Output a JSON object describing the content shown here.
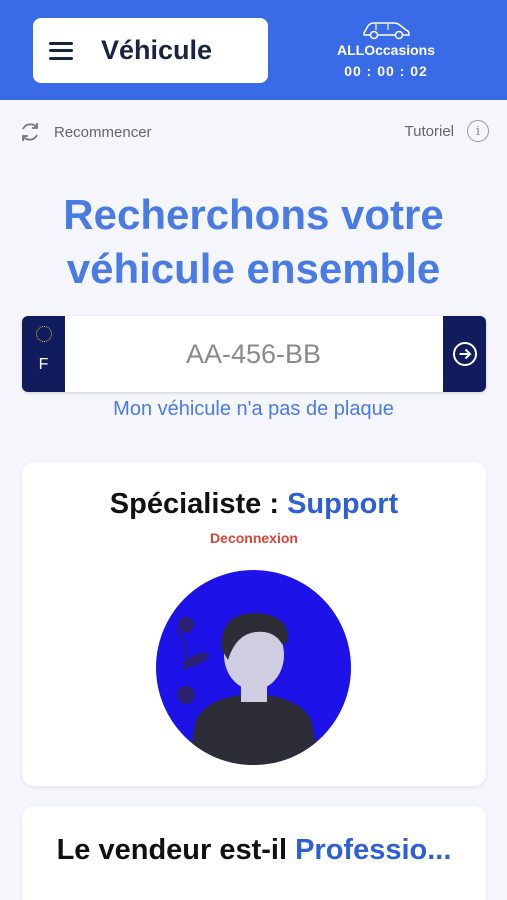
{
  "header": {
    "menu_title": "Véhicule",
    "brand_name": "ALLOccasions",
    "timer": "00 : 00 : 02"
  },
  "toolbar": {
    "restart_label": "Recommencer",
    "tutorial_label": "Tutoriel"
  },
  "hero": {
    "line1": "Recherchons votre",
    "line2": "véhicule ensemble"
  },
  "plate": {
    "country": "F",
    "placeholder": "AA-456-BB"
  },
  "no_plate_link": "Mon véhicule n'a pas de plaque",
  "specialist": {
    "title_prefix": "Spécialiste : ",
    "title_accent": "Support",
    "logout_label": "Deconnexion"
  },
  "seller": {
    "title_prefix": "Le vendeur est-il ",
    "title_accent": "Professio..."
  },
  "colors": {
    "header_bg": "#3a6be6",
    "accent": "#2f5fd6",
    "plate_dark": "#101c5e",
    "logout": "#d9433a",
    "avatar_bg": "#1d13e8"
  },
  "icons": {
    "menu": "hamburger-icon",
    "brand": "car-icon",
    "restart": "refresh-icon",
    "info": "info-icon",
    "submit": "arrow-right-circle-icon"
  }
}
